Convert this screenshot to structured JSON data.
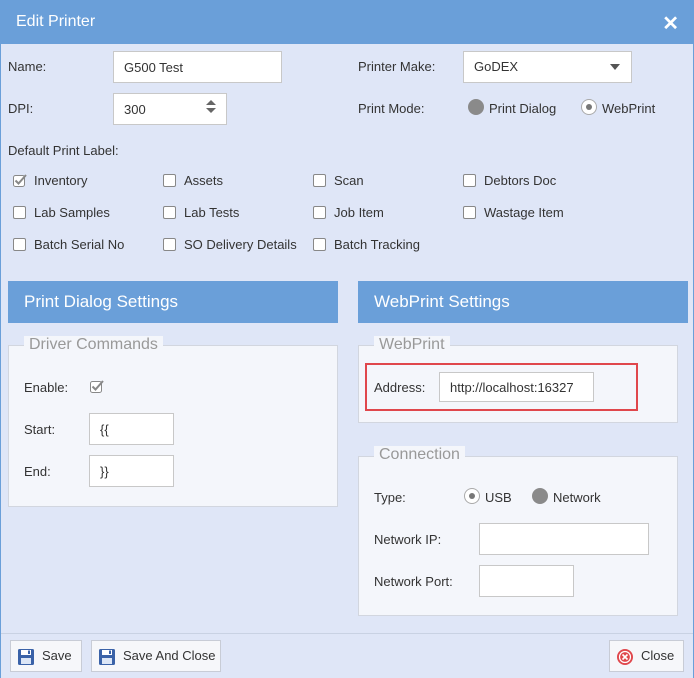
{
  "window": {
    "title": "Edit Printer"
  },
  "fields": {
    "name_label": "Name:",
    "name_value": "G500 Test",
    "dpi_label": "DPI:",
    "dpi_value": "300",
    "printer_make_label": "Printer Make:",
    "printer_make_value": "GoDEX",
    "print_mode_label": "Print Mode:",
    "print_mode_options": [
      "Print Dialog",
      "WebPrint"
    ],
    "print_mode_selected": "WebPrint"
  },
  "default_print_label": {
    "title": "Default Print Label:",
    "items": [
      {
        "label": "Inventory",
        "checked": true
      },
      {
        "label": "Assets",
        "checked": false
      },
      {
        "label": "Scan",
        "checked": false
      },
      {
        "label": "Debtors Doc",
        "checked": false
      },
      {
        "label": "Lab Samples",
        "checked": false
      },
      {
        "label": "Lab Tests",
        "checked": false
      },
      {
        "label": "Job Item",
        "checked": false
      },
      {
        "label": "Wastage Item",
        "checked": false
      },
      {
        "label": "Batch Serial No",
        "checked": false
      },
      {
        "label": "SO Delivery Details",
        "checked": false
      },
      {
        "label": "Batch Tracking",
        "checked": false
      }
    ]
  },
  "print_dialog_settings": {
    "title": "Print Dialog Settings",
    "driver_commands": {
      "legend": "Driver Commands",
      "enable_label": "Enable:",
      "enable_checked": true,
      "start_label": "Start:",
      "start_value": "{{",
      "end_label": "End:",
      "end_value": "}}"
    }
  },
  "webprint_settings": {
    "title": "WebPrint Settings",
    "webprint": {
      "legend": "WebPrint",
      "address_label": "Address:",
      "address_value": "http://localhost:16327"
    },
    "connection": {
      "legend": "Connection",
      "type_label": "Type:",
      "type_options": [
        "USB",
        "Network"
      ],
      "type_selected": "USB",
      "network_ip_label": "Network IP:",
      "network_ip_value": "",
      "network_port_label": "Network Port:",
      "network_port_value": ""
    }
  },
  "footer": {
    "save_label": "Save",
    "save_and_close_label": "Save And Close",
    "close_label": "Close"
  },
  "colors": {
    "accent": "#6a9fd9",
    "background": "#dfe6f7",
    "highlight": "#e0474c"
  }
}
